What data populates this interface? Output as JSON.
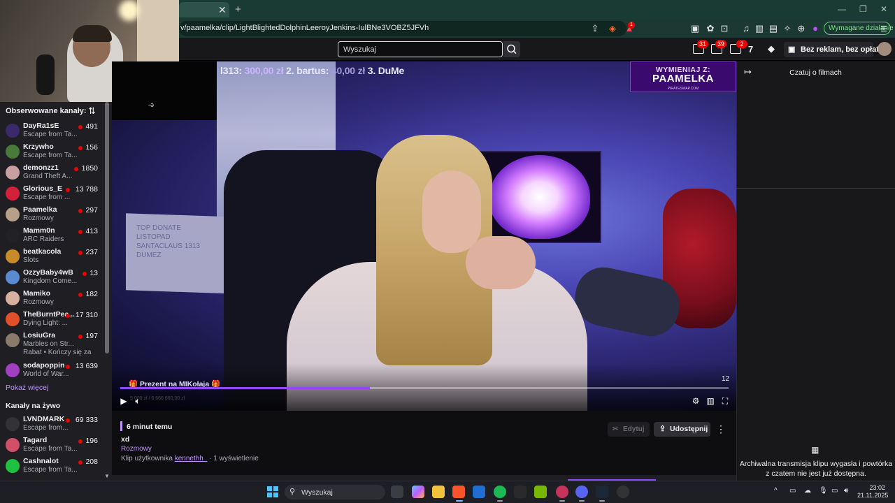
{
  "browser": {
    "url": "v/paamelka/clip/LightBlightedDolphinLeeroyJenkins-IulBNe3VOBZ5JFVh",
    "required_action": "Wymagane działanie",
    "ext_badges": {
      "ext1": "1"
    }
  },
  "topnav": {
    "search_placeholder": "Wyszukaj",
    "badges": {
      "notif1": "31",
      "notif2": "39",
      "notif3": "2"
    },
    "ad_free_label": "Bez reklam, bez opłat"
  },
  "sidebar": {
    "followed_header": "Obserwowane kanały:",
    "channels": [
      {
        "name": "DayRa1sE",
        "game": "Escape from Ta...",
        "viewers": "491",
        "color": "#3b2a6b"
      },
      {
        "name": "Krzywho",
        "game": "Escape from Ta...",
        "viewers": "156",
        "color": "#4a7a3a"
      },
      {
        "name": "demonzz1",
        "game": "Grand Theft A...",
        "viewers": "1850",
        "color": "#c9a0a0"
      },
      {
        "name": "Glorious_E",
        "game": "Escape from ...",
        "viewers": "13 788",
        "color": "#d4213b"
      },
      {
        "name": "Paamelka",
        "game": "Rozmowy",
        "viewers": "297",
        "color": "#b6a08a"
      },
      {
        "name": "Mamm0n",
        "game": "ARC Raiders",
        "viewers": "413",
        "color": "#222"
      },
      {
        "name": "beatkacola",
        "game": "Slots",
        "viewers": "237",
        "color": "#c98a2a"
      },
      {
        "name": "OzzyBaby4wB",
        "game": "Kingdom Come...",
        "viewers": "13",
        "color": "#5a8ad0"
      },
      {
        "name": "Mamiko",
        "game": "Rozmowy",
        "viewers": "182",
        "color": "#d9b0a0"
      },
      {
        "name": "TheBurntPea...",
        "game": "Dying Light: ...",
        "viewers": "17 310",
        "color": "#e0502a"
      },
      {
        "name": "LosiuGra",
        "game": "Marbles on Str...",
        "viewers": "197",
        "color": "#8a7a6a",
        "extra": "Rabat • Kończy się za"
      },
      {
        "name": "sodapoppin",
        "game": "World of War...",
        "viewers": "13 639",
        "color": "#a040c0"
      }
    ],
    "show_more": "Pokaż więcej",
    "live_header": "Kanały na żywo",
    "live_channels": [
      {
        "name": "LVNDMARK",
        "game": "Escape from...",
        "viewers": "69 333",
        "color": "#333"
      },
      {
        "name": "Tagard",
        "game": "Escape from Ta...",
        "viewers": "196",
        "color": "#d0506a"
      },
      {
        "name": "Cashnalot",
        "game": "Escape from Ta...",
        "viewers": "208",
        "color": "#20c040"
      }
    ]
  },
  "video": {
    "donors_ticker": {
      "part1": "l313:",
      "amt1": "300,00 zł",
      "part2": "2. bartus:",
      "amt2": "40,00 zł",
      "part3": "3. DuMe"
    },
    "banner": {
      "line1": "WYMIENIAJ Z:",
      "line2": "PAAMELKA",
      "line3": "PIRATESWAP.COM"
    },
    "gift_text": "🎁 Prezent na MIKołaja 🎁",
    "goal_text": "5 000 zł / 6 666 660,00 zł",
    "board_text": "TOP DONATE\nLISTOPAD\nSANTACLAUS 1313\nDUMEZ",
    "time_label": "12",
    "progress": 0.41
  },
  "clip": {
    "time_ago": "6 minut temu",
    "title": "xd",
    "category": "Rozmowy",
    "by_prefix": "Klip użytkownika",
    "user": "kennethh_",
    "views": "· 1 wyświetlenie",
    "edit_label": "Edytuj",
    "share_label": "Udostępnij"
  },
  "chat": {
    "title": "Czatuj o filmach",
    "message": "Archiwalna transmisja klipu wygasła i powtórka z czatem nie jest już dostępna."
  },
  "taskbar": {
    "search": "Wyszukaj",
    "time": "23:02",
    "date": "21.11.2025"
  }
}
